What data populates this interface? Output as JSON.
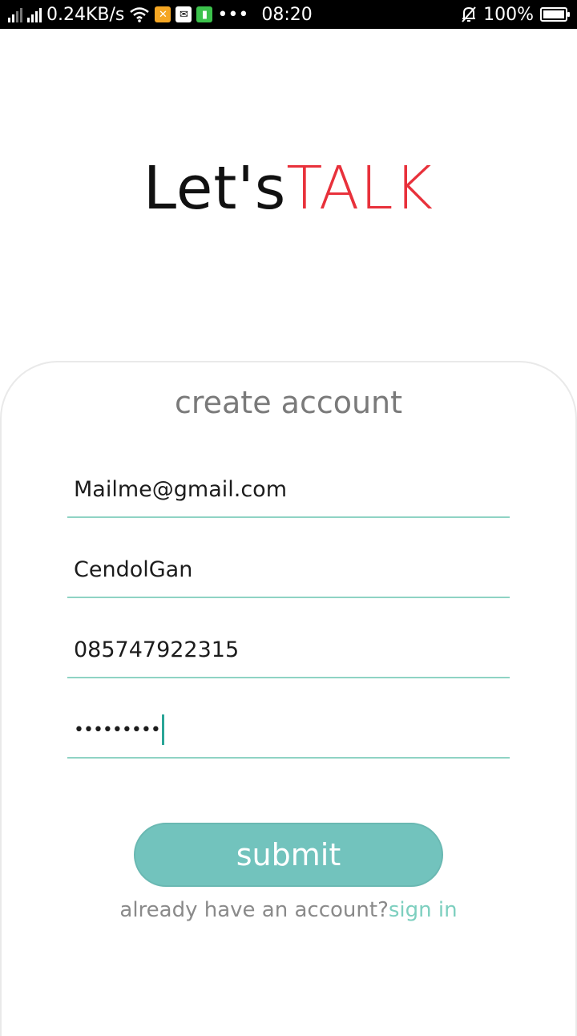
{
  "status_bar": {
    "net_speed": "0.24KB/s",
    "time": "08:20",
    "battery": "100%",
    "more": "•••",
    "icons": [
      "signal-icon",
      "wifi-icon",
      "tool-app-icon",
      "mail-icon",
      "battery-saver-icon",
      "bell-off-icon",
      "battery-icon"
    ]
  },
  "logo": {
    "part1": "Let's",
    "part2": "TALK"
  },
  "form": {
    "title": "create account",
    "email": "Mailme@gmail.com",
    "username": "CendolGan",
    "phone": "085747922315",
    "password_masked": "•••••••••",
    "submit_label": "submit",
    "already_text": "already have an account?",
    "signin_label": "sign in"
  },
  "colors": {
    "accent": "#72c3bd",
    "link": "#7dcfbf",
    "logo_red": "#e8313b",
    "underline": "#8fd3c4"
  }
}
